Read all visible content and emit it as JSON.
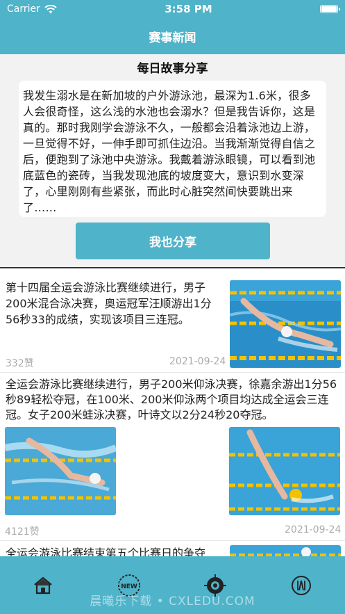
{
  "status_bar": {
    "carrier": "Carrier",
    "time": "3:58 PM"
  },
  "nav": {
    "title": "赛事新闻"
  },
  "story": {
    "title": "每日故事分享",
    "text": "我发生溺水是在新加坡的户外游泳池，最深为1.6米，很多人会很奇怪，这么浅的水池也会溺水？但是我告诉你，这是真的。那时我刚学会游泳不久，一般都会沿着泳池边上游，一旦觉得不好，一伸手即可抓住边沿。当我渐渐觉得自信之后，便跑到了泳池中央游泳。我戴着游泳眼镜，可以看到池底蓝色的瓷砖，当我发现池底的坡度变大，意识到水变深了，心里刚刚有些紧张，而此时心脏突然间快要跳出来了……",
    "share_button": "我也分享"
  },
  "news": [
    {
      "title": "第十四届全运会游泳比赛继续进行，男子200米混合泳决赛，奥运冠军汪顺游出1分56秒33的成绩，实现该项目三连冠。",
      "likes": "332赞",
      "date": "2021-09-24"
    },
    {
      "title": "全运会游泳比赛继续进行，男子200米仰泳决赛，徐嘉余游出1分56秒89轻松夺冠，在100米、200米仰泳两个项目均达成全运会三连冠。女子200米蛙泳决赛，叶诗文以2分24秒20夺冠。",
      "likes": "4121赞",
      "date": "2021-09-24"
    },
    {
      "title": "全运会游泳比赛结束第五个比赛日的争夺"
    }
  ],
  "tabbar": {
    "items": [
      {
        "icon": "home-icon"
      },
      {
        "icon": "news-icon",
        "badge": "NEW"
      },
      {
        "icon": "target-icon"
      },
      {
        "icon": "mine-icon"
      }
    ]
  },
  "watermark": "晨曦乐下载 • CXLEDU.COM",
  "colors": {
    "accent": "#4fb3c9",
    "pool_blue": "#2a8fc8",
    "lane_yellow": "#f2c200"
  }
}
